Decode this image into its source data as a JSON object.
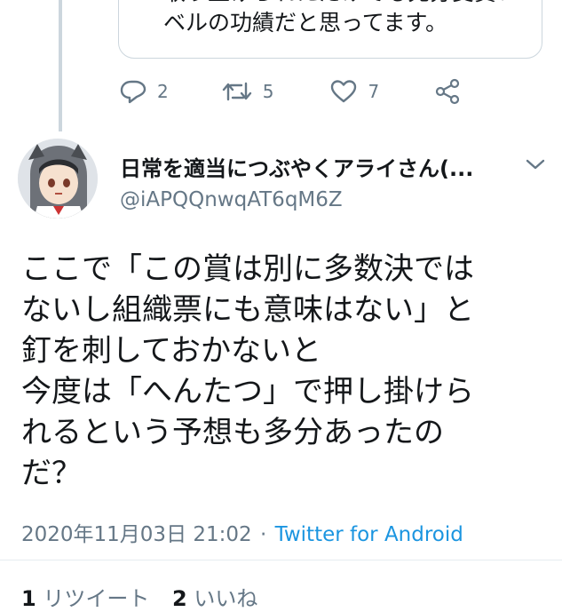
{
  "parent_tweet": {
    "quote_text_line1": "取り上げられただけでも充分受賞レ",
    "quote_text_line2": "ベルの功績だと思ってます。",
    "actions": {
      "reply": {
        "icon": "reply-icon",
        "count": "2"
      },
      "retweet": {
        "icon": "retweet-icon",
        "count": "5"
      },
      "like": {
        "icon": "heart-icon",
        "count": "7"
      },
      "share": {
        "icon": "share-icon"
      }
    }
  },
  "tweet": {
    "display_name": "日常を適当につぶやくアライさん(...",
    "handle": "@iAPQQnwqAT6qM6Z",
    "text": "ここで「この賞は別に多数決では\nないし組織票にも意味はない」と\n釘を刺しておかないと\n今度は「へんたつ」で押し掛けら\nれるという予想も多分あったの\nだ？",
    "timestamp": "2020年11月03日 21:02",
    "separator": "·",
    "source": "Twitter for Android",
    "stats": {
      "retweets_count": "1",
      "retweets_label": "リツイート",
      "likes_count": "2",
      "likes_label": "いいね"
    }
  },
  "colors": {
    "text": "#14171a",
    "secondary": "#657786",
    "link": "#1b95e0",
    "border": "#ccd6dd"
  }
}
